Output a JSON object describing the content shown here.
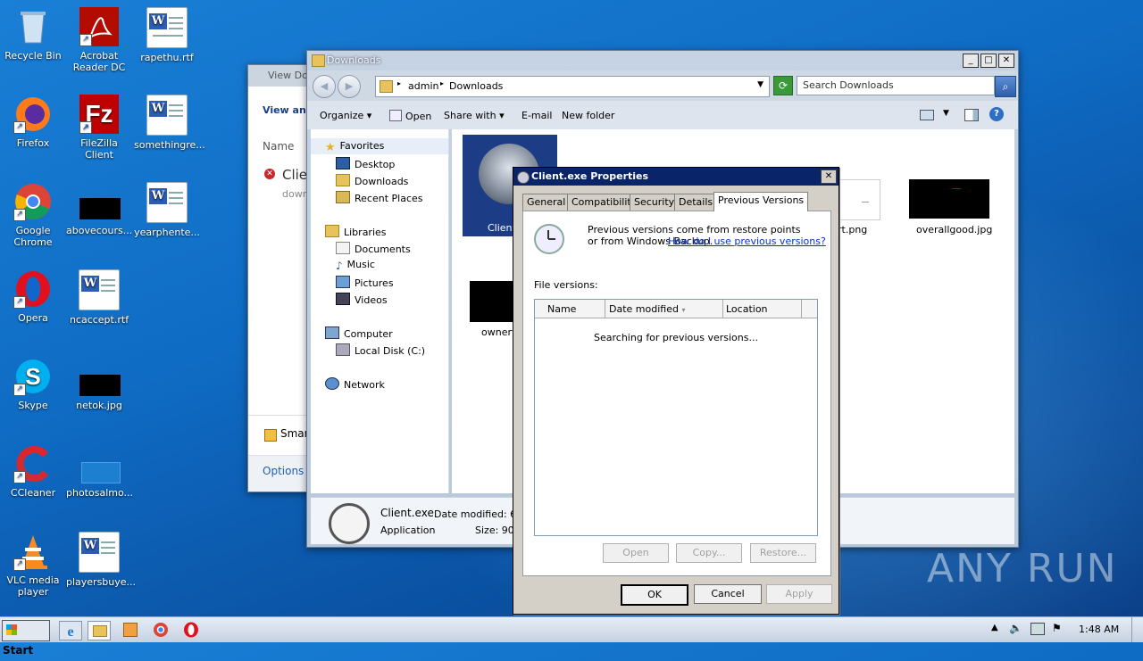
{
  "desktop": {
    "icons": [
      {
        "label": "Recycle Bin"
      },
      {
        "label": "Acrobat Reader DC"
      },
      {
        "label": "rapethu.rtf"
      },
      {
        "label": "Firefox"
      },
      {
        "label": "FileZilla Client"
      },
      {
        "label": "somethingre..."
      },
      {
        "label": "Google Chrome"
      },
      {
        "label": "abovecours..."
      },
      {
        "label": "yearphente..."
      },
      {
        "label": "Opera"
      },
      {
        "label": "ncaccept.rtf"
      },
      {
        "label": "Skype"
      },
      {
        "label": "netok.jpg"
      },
      {
        "label": "CCleaner"
      },
      {
        "label": "photosalmo..."
      },
      {
        "label": "VLC media player"
      },
      {
        "label": "playersbuye..."
      }
    ]
  },
  "back_window": {
    "title": "View Do",
    "heading": "View and",
    "col_name": "Name",
    "item": "Clie",
    "item_sub": "down",
    "smart": "Smar",
    "options": "Options"
  },
  "explorer": {
    "title": "Downloads",
    "breadcrumb": [
      "admin",
      "Downloads"
    ],
    "search_placeholder": "Search Downloads",
    "commands": {
      "organize": "Organize",
      "open": "Open",
      "share": "Share with",
      "email": "E-mail",
      "new_folder": "New folder"
    },
    "nav": {
      "favorites": "Favorites",
      "desktop": "Desktop",
      "downloads": "Downloads",
      "recent": "Recent Places",
      "libraries": "Libraries",
      "documents": "Documents",
      "music": "Music",
      "pictures": "Pictures",
      "videos": "Videos",
      "computer": "Computer",
      "local_disk": "Local Disk (C:)",
      "network": "Network"
    },
    "files": {
      "client": "Client",
      "part_png": "rt.png",
      "overallgood": "overallgood.jpg",
      "ownery": "ownery"
    },
    "details": {
      "name": "Client.exe",
      "type": "Application",
      "date_label": "Date modified: 6/2",
      "size_label": "Size: 90."
    }
  },
  "properties": {
    "title": "Client.exe Properties",
    "tabs": [
      "General",
      "Compatibility",
      "Security",
      "Details",
      "Previous Versions"
    ],
    "info_text": "Previous versions come from restore points or from Windows Backup.",
    "info_link": "How do I use previous versions?",
    "file_versions_label": "File versions:",
    "columns": [
      "Name",
      "Date modified",
      "Location"
    ],
    "searching": "Searching for previous versions...",
    "btn_open": "Open",
    "btn_copy": "Copy...",
    "btn_restore": "Restore...",
    "btn_ok": "OK",
    "btn_cancel": "Cancel",
    "btn_apply": "Apply"
  },
  "taskbar": {
    "start": "Start",
    "time": "1:48 AM"
  },
  "watermark": "ANY RUN"
}
